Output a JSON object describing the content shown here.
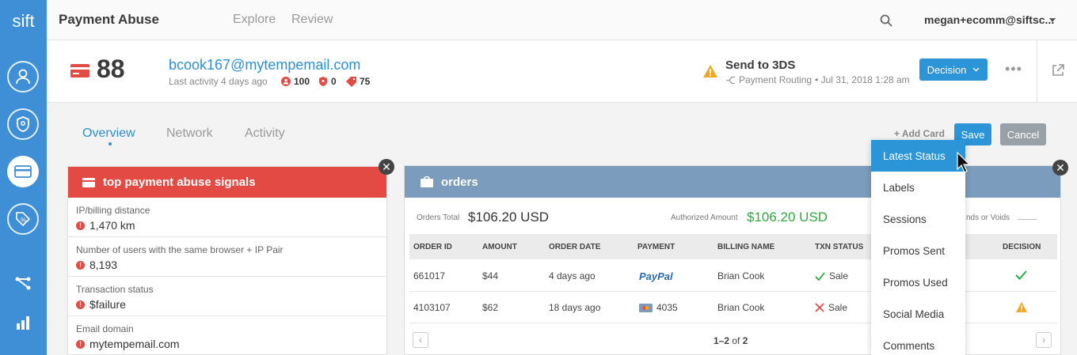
{
  "brand": {
    "logo": "sift",
    "color": "#3f8fd6"
  },
  "topbar": {
    "title": "Payment Abuse",
    "nav": [
      "Explore",
      "Review"
    ],
    "user": "megan+ecomm@siftsc..."
  },
  "header": {
    "score": "88",
    "email": "bcook167@mytempemail.com",
    "last_activity": "Last activity 4 days ago",
    "stats": {
      "users": "100",
      "shield": "0",
      "promos": "75"
    },
    "action": "Send to 3DS",
    "routing": "Payment Routing",
    "routing_time": "• Jul 31, 2018 1:28 am",
    "decision_label": "Decision"
  },
  "tabs": {
    "overview": "Overview",
    "network": "Network",
    "activity": "Activity"
  },
  "toolbar": {
    "add_card": "+ Add Card",
    "save": "Save",
    "cancel": "Cancel"
  },
  "signals": {
    "title": "top payment abuse signals",
    "rows": [
      {
        "label": "IP/billing distance",
        "value": "1,470 km"
      },
      {
        "label": "Number of users with the same browser + IP Pair",
        "value": "8,193"
      },
      {
        "label": "Transaction status",
        "value": "$failure"
      },
      {
        "label": "Email domain",
        "value": "mytempemail.com"
      }
    ]
  },
  "orders": {
    "title": "orders",
    "total_label": "Orders Total",
    "total_value": "$106.20 USD",
    "authorized_label": "Authorized Amount",
    "authorized_value": "$106.20 USD",
    "refunds_label": "nds or Voids",
    "columns": [
      "ORDER ID",
      "AMOUNT",
      "ORDER DATE",
      "PAYMENT",
      "BILLING NAME",
      "TXN STATUS",
      "DECISION"
    ],
    "rows": [
      {
        "id": "661017",
        "amount": "$44",
        "date": "4 days ago",
        "payment": "PayPal",
        "name": "Brian Cook",
        "status": "Sale"
      },
      {
        "id": "4103107",
        "amount": "$62",
        "date": "18 days ago",
        "payment": "4035",
        "name": "Brian Cook",
        "status": "Sale"
      }
    ],
    "pager": {
      "range": "1–2",
      "of": "of",
      "total": "2"
    }
  },
  "dropdown": {
    "items": [
      "Latest Status",
      "Labels",
      "Sessions",
      "Promos Sent",
      "Promos Used",
      "Social Media",
      "Comments"
    ]
  },
  "colors": {
    "accent": "#2b95d8",
    "danger": "#e34a44",
    "success": "#2eaa3f",
    "warning": "#f0a626",
    "orders_header": "#7b9cbc"
  }
}
